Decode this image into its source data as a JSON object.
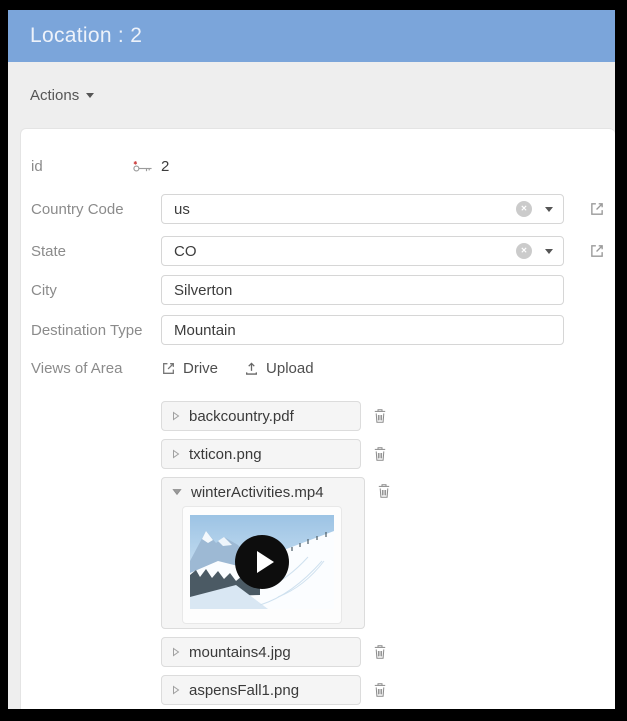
{
  "window": {
    "title": "Location : 2"
  },
  "actions": {
    "label": "Actions"
  },
  "form": {
    "id": {
      "label": "id",
      "value": "2"
    },
    "country_code": {
      "label": "Country Code",
      "value": "us"
    },
    "state": {
      "label": "State",
      "value": "CO"
    },
    "city": {
      "label": "City",
      "value": "Silverton"
    },
    "destination_type": {
      "label": "Destination Type",
      "value": "Mountain"
    },
    "views_of_area": {
      "label": "Views of Area",
      "drive_label": "Drive",
      "upload_label": "Upload"
    }
  },
  "files": {
    "items": [
      {
        "name": "backcountry.pdf",
        "state": "collapsed"
      },
      {
        "name": "txticon.png",
        "state": "collapsed"
      },
      {
        "name": "winterActivities.mp4",
        "state": "expanded"
      },
      {
        "name": "mountains4.jpg",
        "state": "collapsed"
      },
      {
        "name": "aspensFall1.png",
        "state": "collapsed"
      }
    ]
  },
  "glyphs": {
    "clear": "✕"
  },
  "icons": {
    "key": "primary-key",
    "external_link": "open-in-new",
    "upload": "upload-tray",
    "trash": "trash-can",
    "clear": "circle-x",
    "caret_down": "triangle-down",
    "collapsed": "triangle-right-outline",
    "expanded": "triangle-down-filled",
    "play": "play-circle"
  },
  "colors": {
    "header_bg": "#7BA5DA",
    "header_text": "#EDF2FA",
    "page_bg": "#EEEEEE",
    "card_bg": "#FFFFFF",
    "label_text": "#8B8B8B",
    "value_text": "#3C3C3C",
    "file_item_bg": "#F5F5F5",
    "key_star_red": "#CC4040",
    "play_bg": "#0D0D0D"
  }
}
